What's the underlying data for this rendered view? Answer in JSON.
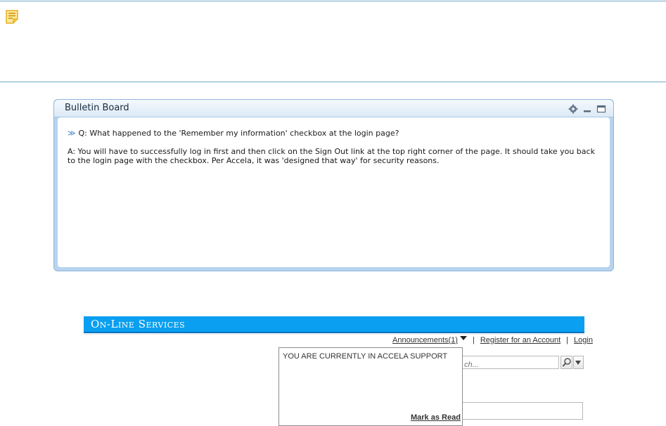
{
  "note": {
    "icon": "note-icon",
    "color": "#f5b400"
  },
  "bulletin_board": {
    "title": "Bulletin Board",
    "icons": [
      "settings-icon",
      "minimize-icon",
      "maximize-icon"
    ],
    "question": "Q: What happened to the 'Remember my information' checkbox at the login page?",
    "question_marker": "≫",
    "answer": "A: You will have to successfully log in first and then click on the Sign Out link at the top right corner of the page. It should take you back to the login page with the checkbox. Per Accela, it was 'designed that way' for security reasons."
  },
  "online_services": {
    "title": "On-Line Services",
    "announcements_label": "Announcements(1)",
    "separator": "|",
    "register_label": "Register for an Account",
    "login_label": "Login",
    "search_placeholder": "ch...",
    "announcement_popup": {
      "text": "YOU ARE CURRENTLY IN ACCELA SUPPORT",
      "mark_as_read": "Mark as Read"
    },
    "accent": "#0a9ff0"
  }
}
